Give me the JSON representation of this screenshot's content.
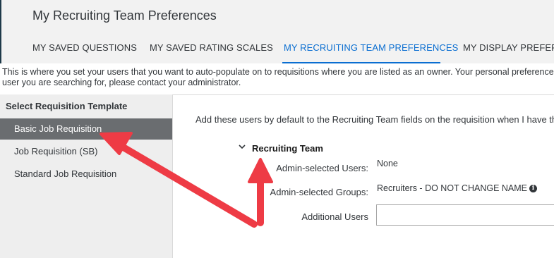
{
  "page_title": "My Recruiting Team Preferences",
  "tabs": [
    {
      "label": "MY SAVED QUESTIONS",
      "active": false
    },
    {
      "label": "MY SAVED RATING SCALES",
      "active": false
    },
    {
      "label": "MY RECRUITING TEAM PREFERENCES",
      "active": true
    },
    {
      "label": "MY DISPLAY PREFERE",
      "active": false
    }
  ],
  "description": {
    "line1": "This is where you set your users that you want to auto-populate on to requisitions where you are listed as an owner. Your personal preference",
    "line2": "user you are searching for, please contact your administrator."
  },
  "sidebar": {
    "header": "Select Requisition Template",
    "items": [
      {
        "label": "Basic Job Requisition",
        "selected": true
      },
      {
        "label": "Job Requisition (SB)",
        "selected": false
      },
      {
        "label": "Standard Job Requisition",
        "selected": false
      }
    ]
  },
  "main": {
    "instruction": "Add these users by default to the Recruiting Team fields on the requisition when I have the f",
    "section": {
      "title": "Recruiting Team",
      "toggle_icon": "chevron-down-icon",
      "fields": {
        "admin_users_label": "Admin-selected Users:",
        "admin_users_value": "None",
        "admin_groups_label": "Admin-selected Groups:",
        "admin_groups_value": "Recruiters - DO NOT CHANGE NAME",
        "additional_users_label": "Additional Users",
        "additional_users_value": ""
      }
    }
  },
  "colors": {
    "accent": "#0a6ed1",
    "selected_bg": "#6a6d70",
    "annotation_arrow": "#ee3b45"
  }
}
